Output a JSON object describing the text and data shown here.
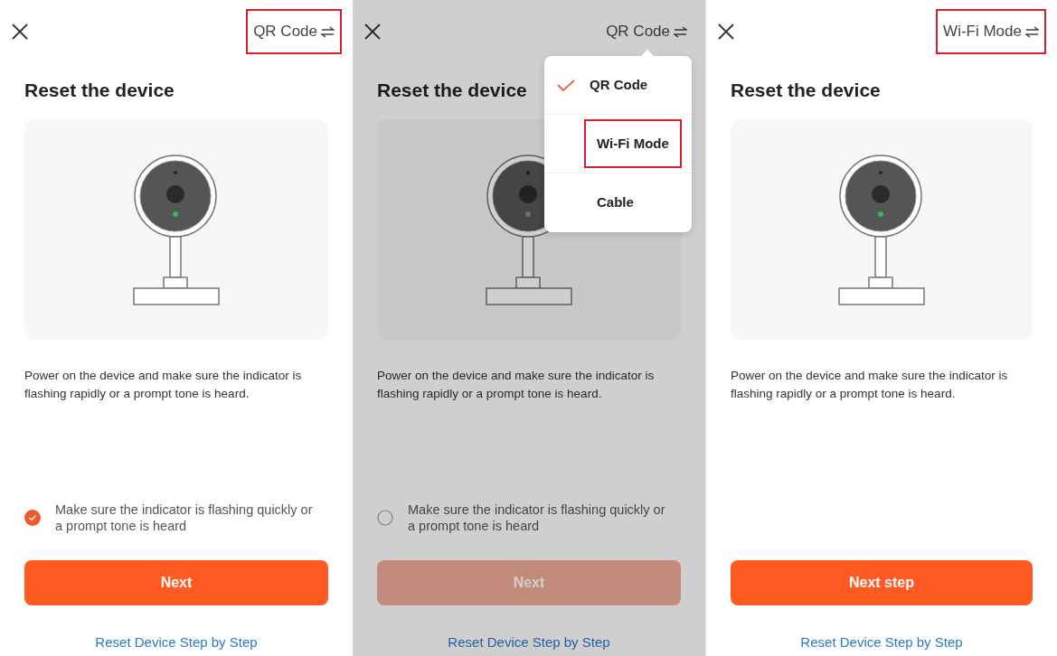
{
  "screens": [
    {
      "dimmed": false,
      "mode_switch": {
        "label": "QR Code",
        "highlighted": true
      },
      "title": "Reset the device",
      "indicator_lit": true,
      "description": "Power on the device and make sure the indicator is flashing rapidly or a prompt tone is heard.",
      "confirm": {
        "text": "Make sure the indicator is flashing quickly or a prompt tone is heard",
        "checked": true
      },
      "button": {
        "label": "Next",
        "disabled": false
      },
      "link": "Reset Device Step by Step"
    },
    {
      "dimmed": true,
      "mode_switch": {
        "label": "QR Code",
        "highlighted": false
      },
      "menu": [
        {
          "label": "QR Code",
          "selected": true,
          "highlighted": false
        },
        {
          "label": "Wi-Fi Mode",
          "selected": false,
          "highlighted": true
        },
        {
          "label": "Cable",
          "selected": false,
          "highlighted": false
        }
      ],
      "title": "Reset the device",
      "indicator_lit": false,
      "description": "Power on the device and make sure the indicator is flashing rapidly or a prompt tone is heard.",
      "confirm": {
        "text": "Make sure the indicator is flashing quickly or a prompt tone is heard",
        "checked": false
      },
      "button": {
        "label": "Next",
        "disabled": true
      },
      "link": "Reset Device Step by Step"
    },
    {
      "dimmed": false,
      "mode_switch": {
        "label": "Wi-Fi Mode",
        "highlighted": true
      },
      "title": "Reset the device",
      "indicator_lit": true,
      "description": "Power on the device and make sure the indicator is flashing rapidly or a prompt tone is heard.",
      "button": {
        "label": "Next step",
        "disabled": false
      },
      "link": "Reset Device Step by Step"
    }
  ]
}
